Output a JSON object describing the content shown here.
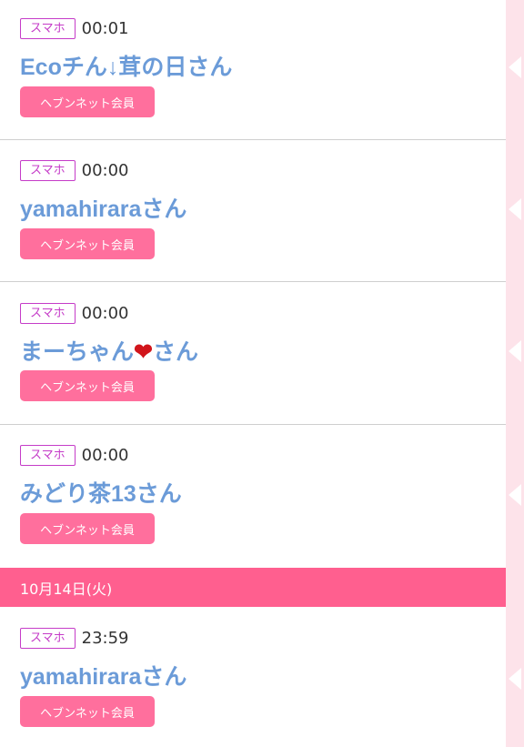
{
  "entries": [
    {
      "device": "スマホ",
      "time": "00:01",
      "name": "Ecoチん↓茸の日さん",
      "badge": "ヘブンネット会員"
    },
    {
      "device": "スマホ",
      "time": "00:00",
      "name": "yamahiraraさん",
      "badge": "ヘブンネット会員"
    },
    {
      "device": "スマホ",
      "time": "00:00",
      "name_before": "まーちゃん",
      "name_emoji": "❤",
      "name_after": "さん",
      "badge": "ヘブンネット会員"
    },
    {
      "device": "スマホ",
      "time": "00:00",
      "name": "みどり茶13さん",
      "badge": "ヘブンネット会員"
    }
  ],
  "date_header": "10月14日(火)",
  "next_day_entries": [
    {
      "device": "スマホ",
      "time": "23:59",
      "name": "yamahiraraさん",
      "badge": "ヘブンネット会員"
    }
  ],
  "colors": {
    "name": "#6b9bd8",
    "device_tag": "#c53cc8",
    "badge_bg": "#ff6f9d",
    "date_band": "#ff5f8f",
    "side_rail": "#fde3ea"
  },
  "icons": {
    "heart": "heart-emoji",
    "rail_arrow": "chevron-left-icon"
  }
}
